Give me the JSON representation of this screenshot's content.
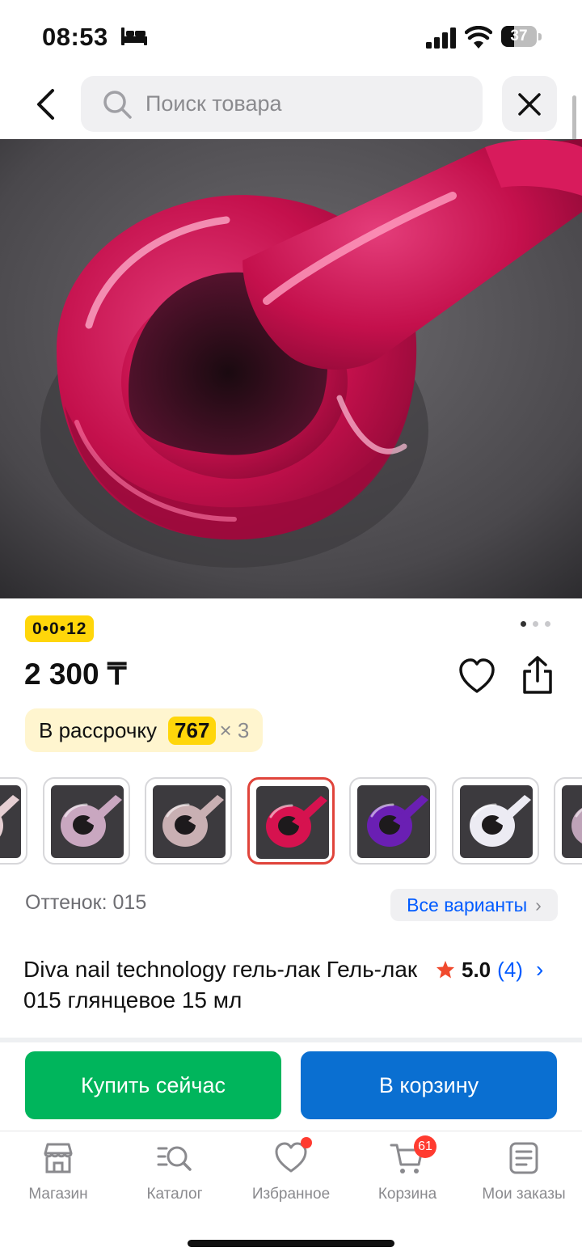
{
  "status_bar": {
    "time": "08:53",
    "battery": "37",
    "battery_level": 0.37
  },
  "header": {
    "search_placeholder": "Поиск товара"
  },
  "product": {
    "badge": "0•0•12",
    "price": "2 300 ₸",
    "installment": {
      "label": "В рассрочку",
      "amount": "767",
      "multiplier": "× 3"
    },
    "shade_label": "Оттенок: 015",
    "all_variants": "Все варианты",
    "title": "Diva nail technology гель-лак Гель-лак 015 глянцевое 15 мл",
    "rating": {
      "score": "5.0",
      "count": "(4)"
    },
    "gallery": {
      "pages": 3,
      "current": 1
    },
    "variant_colors": [
      "#e6cfd3",
      "#c9a7c0",
      "#c9b0b3",
      "#d6124f",
      "#6a1fb3",
      "#ecebf3",
      "#bea3b8"
    ],
    "selected_variant_index": 3
  },
  "actions": {
    "buy_now": "Купить сейчас",
    "add_to_cart": "В корзину"
  },
  "tabbar": {
    "items": [
      {
        "label": "Магазин",
        "icon": "store-icon"
      },
      {
        "label": "Каталог",
        "icon": "catalog-search-icon"
      },
      {
        "label": "Избранное",
        "icon": "heart-icon"
      },
      {
        "label": "Корзина",
        "icon": "cart-icon",
        "badge": "61"
      },
      {
        "label": "Мои заказы",
        "icon": "orders-icon"
      }
    ]
  },
  "colors": {
    "accent_blue": "#005bff",
    "buy_green": "#00b55c",
    "cart_blue": "#0a6fd1",
    "badge_yellow": "#ffd60a",
    "alert_red": "#ff3b30"
  }
}
